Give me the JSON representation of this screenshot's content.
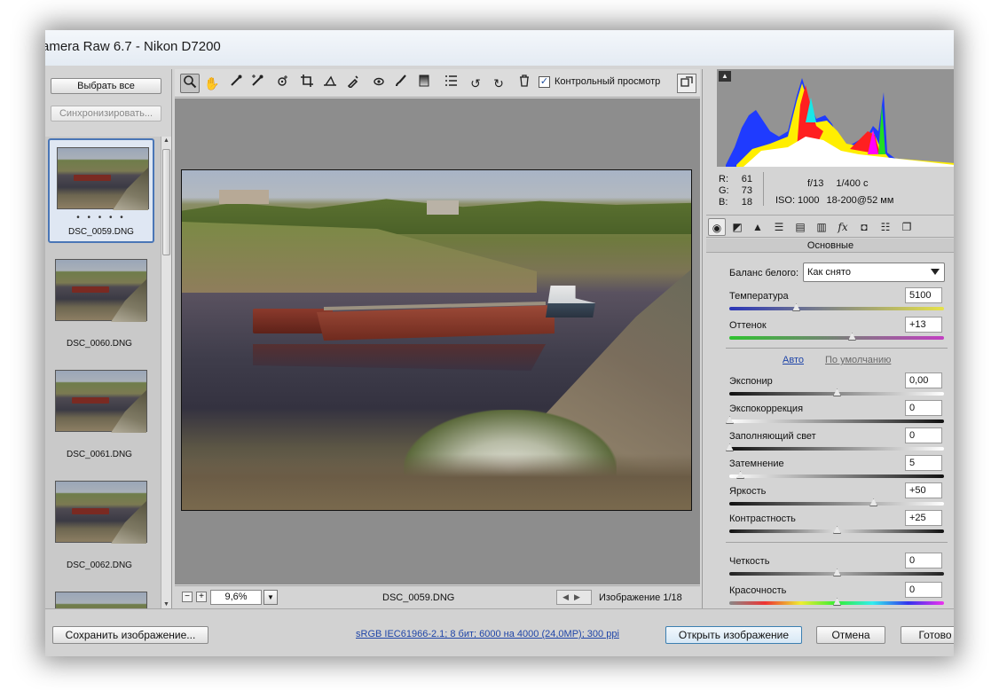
{
  "window": {
    "title": "amera Raw 6.7  -  Nikon D7200"
  },
  "filmstrip": {
    "select_all": "Выбрать все",
    "synchronize": "Синхронизировать...",
    "thumbnails": [
      {
        "name": "DSC_0059.DNG",
        "rating": "• • • • •",
        "selected": true
      },
      {
        "name": "DSC_0060.DNG"
      },
      {
        "name": "DSC_0061.DNG"
      },
      {
        "name": "DSC_0062.DNG"
      },
      {
        "name": ""
      }
    ]
  },
  "toolbar": {
    "tools": [
      "zoom-icon",
      "hand-icon",
      "white-balance-icon",
      "color-sampler-icon",
      "target-adjust-icon",
      "crop-icon",
      "straighten-icon",
      "spot-removal-icon",
      "red-eye-icon",
      "adjustment-brush-icon",
      "graduated-filter-icon",
      "preferences-icon",
      "rotate-left-icon",
      "rotate-right-icon",
      "trash-icon"
    ],
    "preview_checked": true,
    "preview_label": "Контрольный просмотр"
  },
  "canvas": {
    "zoom": "9,6%",
    "filename": "DSC_0059.DNG",
    "image_count": "Изображение 1/18"
  },
  "info": {
    "r_label": "R:",
    "r_value": "61",
    "g_label": "G:",
    "g_value": "73",
    "b_label": "B:",
    "b_value": "18",
    "aperture": "f/13",
    "shutter": "1/400 с",
    "iso": "ISO: 1000",
    "lens": "18-200@52 мм"
  },
  "panel": {
    "section_title": "Основные",
    "white_balance_label": "Баланс белого:",
    "white_balance_value": "Как снято",
    "auto_link": "Авто",
    "default_link": "По умолчанию",
    "params": [
      {
        "label": "Температура",
        "value": "5100",
        "slider": 0.31
      },
      {
        "label": "Оттенок",
        "value": "+13",
        "slider": 0.57
      },
      {
        "label": "Экспонир",
        "value": "0,00",
        "slider": 0.5
      },
      {
        "label": "Экспокоррекция",
        "value": "0",
        "slider": 0.0
      },
      {
        "label": "Заполняющий свет",
        "value": "0",
        "slider": 0.0
      },
      {
        "label": "Затемнение",
        "value": "5",
        "slider": 0.05
      },
      {
        "label": "Яркость",
        "value": "+50",
        "slider": 0.67
      },
      {
        "label": "Контрастность",
        "value": "+25",
        "slider": 0.5
      },
      {
        "label": "Четкость",
        "value": "0",
        "slider": 0.5
      },
      {
        "label": "Красочность",
        "value": "0",
        "slider": 0.5
      }
    ]
  },
  "footer": {
    "save": "Сохранить изображение...",
    "workflow": "sRGB IEC61966-2.1; 8 бит; 6000 на 4000 (24,0МР); 300 ppi",
    "open": "Открыть изображение",
    "cancel": "Отмена",
    "done": "Готово"
  },
  "colors": {
    "accent": "#4a76b6",
    "link": "#1f45a8"
  }
}
